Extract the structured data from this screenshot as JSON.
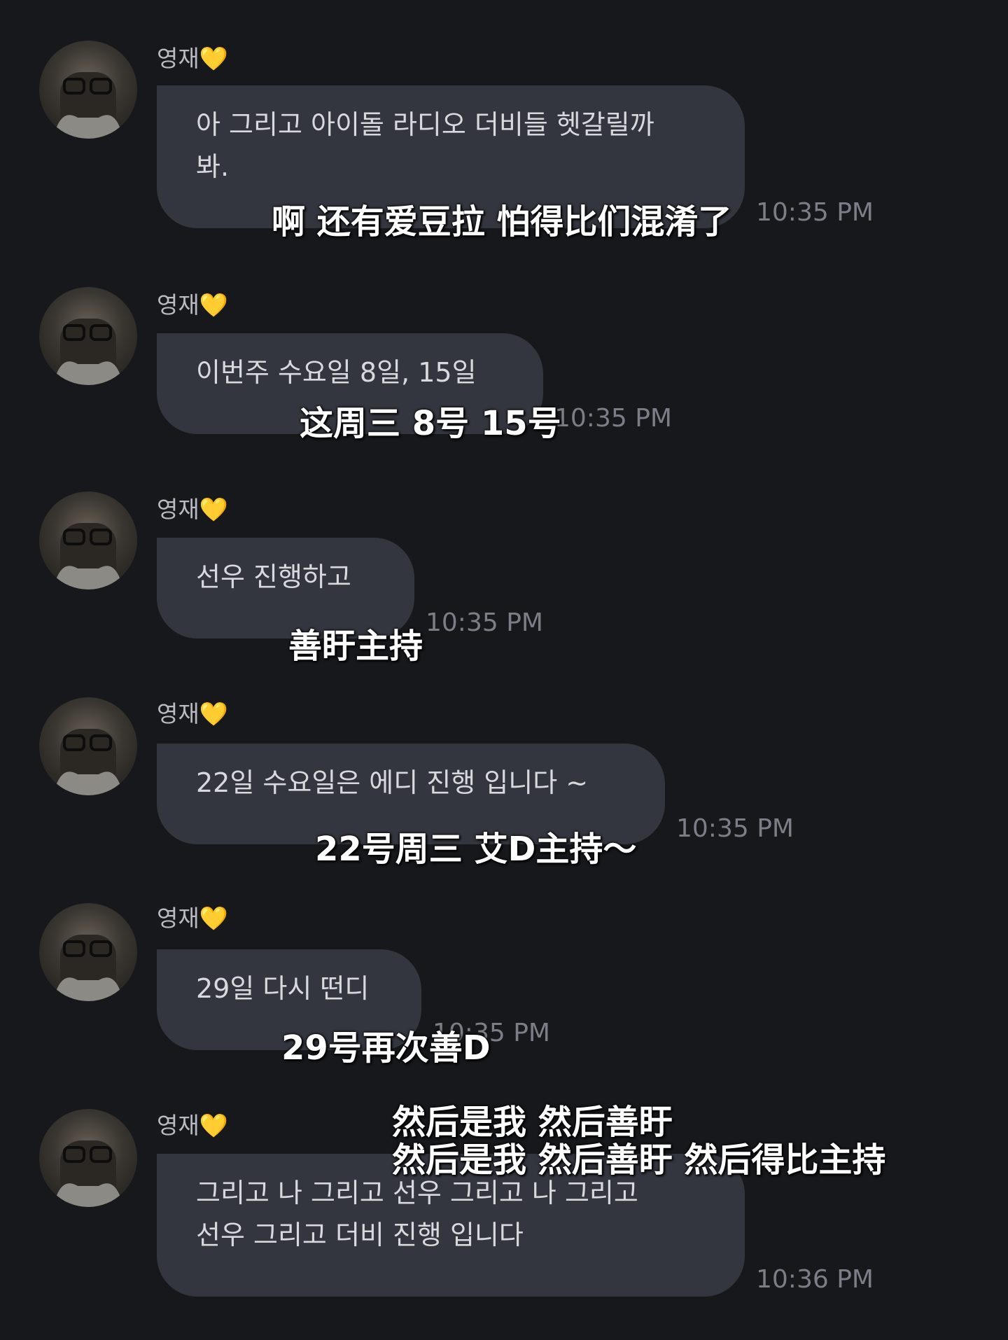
{
  "messages": [
    {
      "sender": "영재💛",
      "lines": [
        "아 그리고 아이돌 라디오 더비들 헷갈릴까",
        "봐."
      ],
      "time": "10:35 PM",
      "subtitle": [
        "啊 还有爱豆拉 怕得比们混淆了"
      ]
    },
    {
      "sender": "영재💛",
      "lines": [
        "이번주 수요일 8일, 15일"
      ],
      "time": "10:35 PM",
      "subtitle": [
        "这周三 8号 15号"
      ]
    },
    {
      "sender": "영재💛",
      "lines": [
        "선우 진행하고"
      ],
      "time": "10:35 PM",
      "subtitle": [
        "善盱主持"
      ]
    },
    {
      "sender": "영재💛",
      "lines": [
        "22일 수요일은 에디 진행 입니다 ~"
      ],
      "time": "10:35 PM",
      "subtitle": [
        "22号周三 艾D主持～"
      ]
    },
    {
      "sender": "영재💛",
      "lines": [
        "29일 다시 떤디"
      ],
      "time": "10:35 PM",
      "subtitle": [
        "29号再次善D"
      ]
    },
    {
      "sender": "영재💛",
      "lines": [
        "그리고 나 그리고 선우 그리고 나 그리고",
        "선우 그리고 더비 진행 입니다"
      ],
      "time": "10:36 PM",
      "subtitle": [
        "然后是我 然后善盱",
        "然后是我 然后善盱 然后得比主持"
      ]
    }
  ]
}
